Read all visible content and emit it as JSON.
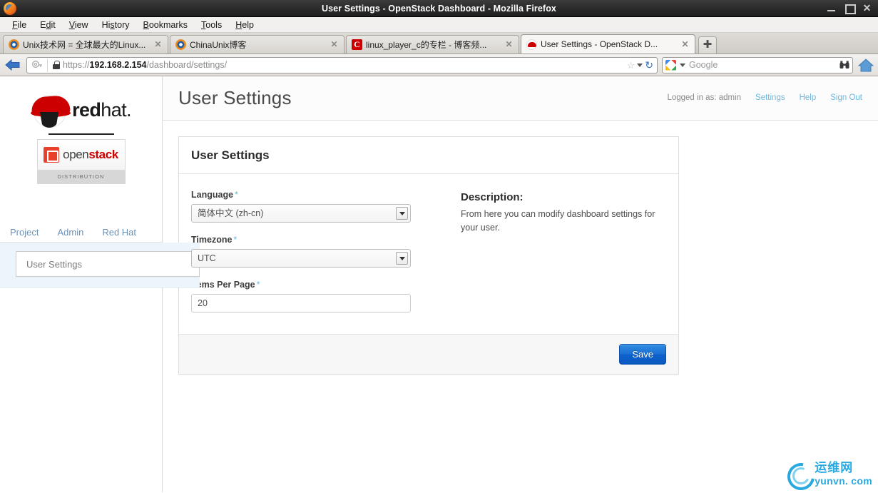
{
  "window": {
    "title": "User Settings - OpenStack Dashboard - Mozilla Firefox",
    "app_icon": "firefox-icon",
    "minimize_label": "",
    "maximize_label": "",
    "close_label": "✕"
  },
  "menubar": {
    "items": [
      {
        "label": "File",
        "accel": "F"
      },
      {
        "label": "Edit",
        "accel": "E"
      },
      {
        "label": "View",
        "accel": "V"
      },
      {
        "label": "History",
        "accel": "s"
      },
      {
        "label": "Bookmarks",
        "accel": "B"
      },
      {
        "label": "Tools",
        "accel": "T"
      },
      {
        "label": "Help",
        "accel": "H"
      }
    ]
  },
  "tabs": {
    "items": [
      {
        "label": "Unix技术网 = 全球最大的Linux...",
        "favicon": "unix-favicon",
        "active": false,
        "close": "✕"
      },
      {
        "label": "ChinaUnix博客",
        "favicon": "unix-favicon",
        "active": false,
        "close": "✕"
      },
      {
        "label": "linux_player_c的专栏 - 博客频...",
        "favicon": "csdn-favicon",
        "active": false,
        "close": "✕"
      },
      {
        "label": "User Settings - OpenStack D...",
        "favicon": "redhat-favicon",
        "active": true,
        "close": "✕"
      }
    ],
    "new_tab_label": "✚"
  },
  "navbar": {
    "back_label": "Back",
    "url_scheme": "https://",
    "url_host": "192.168.2.154",
    "url_path": "/dashboard/settings/",
    "url_full": "https://192.168.2.154/dashboard/settings/",
    "bookmark_star": "☆",
    "reload_glyph": "↻",
    "search_engine": "google-icon",
    "search_placeholder": "Google",
    "search_value": "",
    "binoculars_glyph": "نن",
    "home_label": "Home"
  },
  "sidebar": {
    "brand": {
      "redhat_bold": "red",
      "redhat_light": "hat.",
      "openstack_open": "open",
      "openstack_stack": "stack",
      "distribution_label": "DISTRIBUTION"
    },
    "nav_tabs": [
      {
        "label": "Project"
      },
      {
        "label": "Admin"
      },
      {
        "label": "Red Hat"
      }
    ],
    "active_item": "User Settings"
  },
  "header": {
    "page_title": "User Settings",
    "logged_in_as": "Logged in as: admin",
    "links": [
      {
        "label": "Settings"
      },
      {
        "label": "Help"
      },
      {
        "label": "Sign Out"
      }
    ]
  },
  "panel": {
    "title": "User Settings",
    "fields": {
      "language": {
        "label": "Language",
        "required_mark": "*",
        "value": "简体中文 (zh-cn)"
      },
      "timezone": {
        "label": "Timezone",
        "required_mark": "*",
        "value": "UTC"
      },
      "items_per_page": {
        "label": "Items Per Page",
        "required_mark": "*",
        "value": "20"
      }
    },
    "description": {
      "title": "Description:",
      "text": "From here you can modify dashboard settings for your user."
    },
    "save_label": "Save"
  },
  "watermark": {
    "cn": "运维网",
    "en": "yunvn. com"
  },
  "colors": {
    "accent_link": "#6cb8e0",
    "save_button": "#1b6fd4",
    "redhat_red": "#cc0000",
    "openstack_red": "#e8402a",
    "sidebar_panel_bg": "#ecf5fb",
    "watermark_blue": "#2aa8e0"
  }
}
